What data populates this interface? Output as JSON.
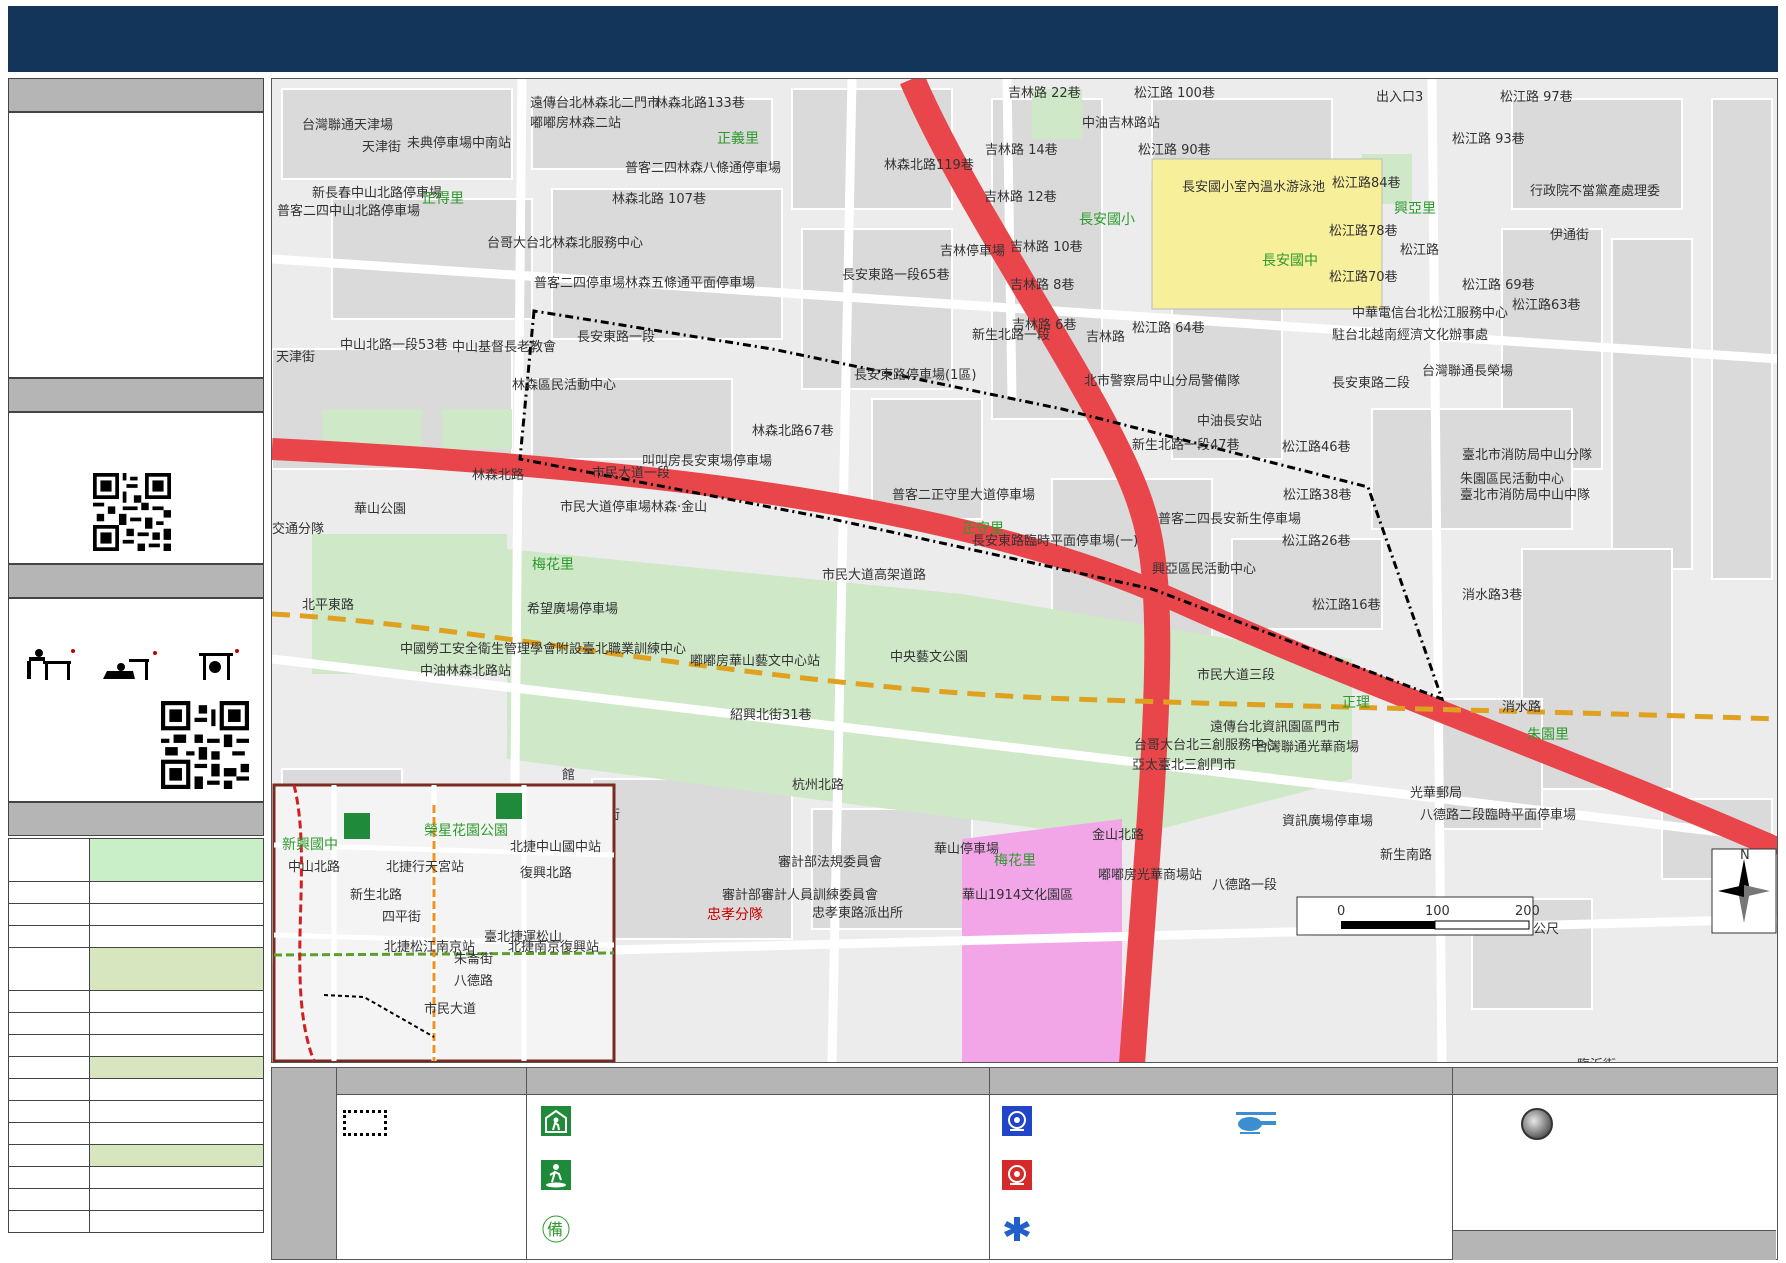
{
  "map": {
    "labels": [
      {
        "text": "遠傳台北林森北二門市",
        "cls": "lbl"
      },
      {
        "text": "林森北路133巷",
        "cls": "lbl"
      },
      {
        "text": "嘟嘟房林森二站",
        "cls": "lbl"
      },
      {
        "text": "台灣聯通天津場",
        "cls": "lbl"
      },
      {
        "text": "未典停車場中南站",
        "cls": "lbl"
      },
      {
        "text": "正義里",
        "cls": "lbl-g"
      },
      {
        "text": "普客二四林森八條通停車場",
        "cls": "lbl"
      },
      {
        "text": "林森北路119巷",
        "cls": "lbl"
      },
      {
        "text": "吉林路 22巷",
        "cls": "lbl"
      },
      {
        "text": "松江路 100巷",
        "cls": "lbl"
      },
      {
        "text": "出入口3",
        "cls": "lbl"
      },
      {
        "text": "松江路 97巷",
        "cls": "lbl"
      },
      {
        "text": "中油吉林路站",
        "cls": "lbl"
      },
      {
        "text": "吉林路 14巷",
        "cls": "lbl"
      },
      {
        "text": "松江路 90巷",
        "cls": "lbl"
      },
      {
        "text": "松江路 93巷",
        "cls": "lbl"
      },
      {
        "text": "天津街",
        "cls": "lbl"
      },
      {
        "text": "新長春中山北路停車場",
        "cls": "lbl"
      },
      {
        "text": "正得里",
        "cls": "lbl-g"
      },
      {
        "text": "普客二四中山北路停車場",
        "cls": "lbl"
      },
      {
        "text": "林森北路 107巷",
        "cls": "lbl"
      },
      {
        "text": "吉林路 12巷",
        "cls": "lbl"
      },
      {
        "text": "長安國小室內溫水游泳池",
        "cls": "lbl"
      },
      {
        "text": "興亞里",
        "cls": "lbl-g"
      },
      {
        "text": "松江路84巷",
        "cls": "lbl"
      },
      {
        "text": "行政院不當黨產處理委",
        "cls": "lbl"
      },
      {
        "text": "長安國小",
        "cls": "lbl-g"
      },
      {
        "text": "長安國中",
        "cls": "lbl-g"
      },
      {
        "text": "台哥大台北林森北服務中心",
        "cls": "lbl"
      },
      {
        "text": "吉林停車場",
        "cls": "lbl"
      },
      {
        "text": "吉林路 10巷",
        "cls": "lbl"
      },
      {
        "text": "松江路78巷",
        "cls": "lbl"
      },
      {
        "text": "松江路70巷",
        "cls": "lbl"
      },
      {
        "text": "普客二四停車場林森五條通平面停車場",
        "cls": "lbl"
      },
      {
        "text": "吉林路 8巷",
        "cls": "lbl"
      },
      {
        "text": "松江路 69巷",
        "cls": "lbl"
      },
      {
        "text": "中華電信台北松江服務中心",
        "cls": "lbl"
      },
      {
        "text": "駐台北越南經濟文化辦事處",
        "cls": "lbl"
      },
      {
        "text": "松江路63巷",
        "cls": "lbl"
      },
      {
        "text": "中山北路一段53巷",
        "cls": "lbl"
      },
      {
        "text": "中山基督長老教會",
        "cls": "lbl"
      },
      {
        "text": "長安東路一段",
        "cls": "lbl"
      },
      {
        "text": "吉林路 6巷",
        "cls": "lbl"
      },
      {
        "text": "松江路 64巷",
        "cls": "lbl"
      },
      {
        "text": "新生北路一段",
        "cls": "lbl"
      },
      {
        "text": "林森區民活動中心",
        "cls": "lbl"
      },
      {
        "text": "長安東路停車場(1區)",
        "cls": "lbl"
      },
      {
        "text": "北市警察局中山分局警備隊",
        "cls": "lbl"
      },
      {
        "text": "長安東路二段",
        "cls": "lbl"
      },
      {
        "text": "台灣聯通長榮場",
        "cls": "lbl"
      },
      {
        "text": "林森北路67巷",
        "cls": "lbl"
      },
      {
        "text": "中油長安站",
        "cls": "lbl"
      },
      {
        "text": "新生北路一段47巷",
        "cls": "lbl"
      },
      {
        "text": "松江路46巷",
        "cls": "lbl"
      },
      {
        "text": "臺北市消防局中山分隊",
        "cls": "lbl"
      },
      {
        "text": "朱園區民活動中心",
        "cls": "lbl"
      },
      {
        "text": "臺北市消防局中山中隊",
        "cls": "lbl"
      },
      {
        "text": "叫叫房長安東場停車場",
        "cls": "lbl"
      },
      {
        "text": "市民大道一段",
        "cls": "lbl"
      },
      {
        "text": "華山公園",
        "cls": "lbl"
      },
      {
        "text": "市民大道停車場林森‧金山",
        "cls": "lbl"
      },
      {
        "text": "普客二正守里大道停車場",
        "cls": "lbl"
      },
      {
        "text": "松江路38巷",
        "cls": "lbl"
      },
      {
        "text": "普客二四長安新生停車場",
        "cls": "lbl"
      },
      {
        "text": "長安東路臨時平面停車場(一)",
        "cls": "lbl"
      },
      {
        "text": "松江路26巷",
        "cls": "lbl"
      },
      {
        "text": "興亞區民活動中心",
        "cls": "lbl"
      },
      {
        "text": "市民大道高架道路",
        "cls": "lbl"
      },
      {
        "text": "交通分隊",
        "cls": "lbl"
      },
      {
        "text": "梅花里",
        "cls": "lbl-g"
      },
      {
        "text": "北平東路",
        "cls": "lbl"
      },
      {
        "text": "松江路16巷",
        "cls": "lbl"
      },
      {
        "text": "希望廣場停車場",
        "cls": "lbl"
      },
      {
        "text": "中國勞工安全衛生管理學會附設臺北職業訓練中心",
        "cls": "lbl"
      },
      {
        "text": "中油林森北路站",
        "cls": "lbl"
      },
      {
        "text": "嘟嘟房華山藝文中心站",
        "cls": "lbl"
      },
      {
        "text": "中央藝文公園",
        "cls": "lbl"
      },
      {
        "text": "市民大道三段",
        "cls": "lbl"
      },
      {
        "text": "消水路",
        "cls": "lbl"
      },
      {
        "text": "遠傳台北資訊園區門市",
        "cls": "lbl"
      },
      {
        "text": "朱園里",
        "cls": "lbl-g"
      },
      {
        "text": "台哥大台北三創服務中心",
        "cls": "lbl"
      },
      {
        "text": "台灣聯通光華商場",
        "cls": "lbl"
      },
      {
        "text": "亞太臺北三創門市",
        "cls": "lbl"
      },
      {
        "text": "光華郵局",
        "cls": "lbl"
      },
      {
        "text": "八德路二段臨時平面停車場",
        "cls": "lbl"
      },
      {
        "text": "紹興北街31巷",
        "cls": "lbl"
      },
      {
        "text": "杭州北路",
        "cls": "lbl"
      },
      {
        "text": "紹興北街",
        "cls": "lbl"
      },
      {
        "text": "資訊廣場停車場",
        "cls": "lbl"
      },
      {
        "text": "華山停車場",
        "cls": "lbl"
      },
      {
        "text": "審計部法規委員會",
        "cls": "lbl"
      },
      {
        "text": "梅花里",
        "cls": "lbl-g"
      },
      {
        "text": "華山1914文化園區",
        "cls": "lbl"
      },
      {
        "text": "嘟嘟房光華商場站",
        "cls": "lbl"
      },
      {
        "text": "審計部審計人員訓練委員會",
        "cls": "lbl"
      },
      {
        "text": "忠孝分隊",
        "cls": "lbl-r"
      },
      {
        "text": "忠孝東路派出所",
        "cls": "lbl"
      },
      {
        "text": "八德路一段",
        "cls": "lbl"
      },
      {
        "text": "新生南路",
        "cls": "lbl"
      },
      {
        "text": "金山北路",
        "cls": "lbl"
      },
      {
        "text": "長安東路一段65巷",
        "cls": "lbl"
      },
      {
        "text": "林森北路",
        "cls": "lbl"
      },
      {
        "text": "松江路",
        "cls": "lbl"
      },
      {
        "text": "伊通街",
        "cls": "lbl"
      },
      {
        "text": "天津街",
        "cls": "lbl"
      },
      {
        "text": "吉林路",
        "cls": "lbl"
      },
      {
        "text": "消水路3巷",
        "cls": "lbl"
      },
      {
        "text": "臨沂街",
        "cls": "lbl"
      },
      {
        "text": "館",
        "cls": "lbl"
      },
      {
        "text": "正守里",
        "cls": "lbl-g"
      },
      {
        "text": "正理",
        "cls": "lbl-g"
      }
    ],
    "scalebar": {
      "ticks": [
        "0",
        "100",
        "200"
      ],
      "unit": "公尺"
    },
    "north": "N",
    "inset": {
      "labels": [
        "新興國中",
        "榮星花園公園",
        "中山北路",
        "北捷行天宮站",
        "北捷中山國中站",
        "復興北路",
        "新生北路",
        "四平街",
        "北捷松江南京站",
        "北捷南京復興站",
        "朱崙街",
        "八德路",
        "臺北捷運松山",
        "市民大道"
      ]
    }
  },
  "colors": {
    "header": "#123559",
    "panel_bar": "#b5b5b5",
    "road_main": "#e8464b",
    "park": "#cfe8c8",
    "pink": "#f2a6e8",
    "school": "#f8ef9a",
    "rail": "#e0a020",
    "boundary": "#000000",
    "light_green": "#c8efc8",
    "olive_green": "#d8e6bf"
  },
  "icons": {
    "parking": "parking-icon",
    "shelter": "shelter-icon",
    "evacuation": "evacuation-park-icon",
    "reserve": "reserve-備-icon",
    "police": "police-icon",
    "fire": "fire-station-icon",
    "medical": "medical-icon",
    "helicopter": "helicopter-icon",
    "point": "grey-point-icon"
  },
  "legend": {
    "reserve_char": "備"
  },
  "left_table": {
    "rows": 18
  }
}
